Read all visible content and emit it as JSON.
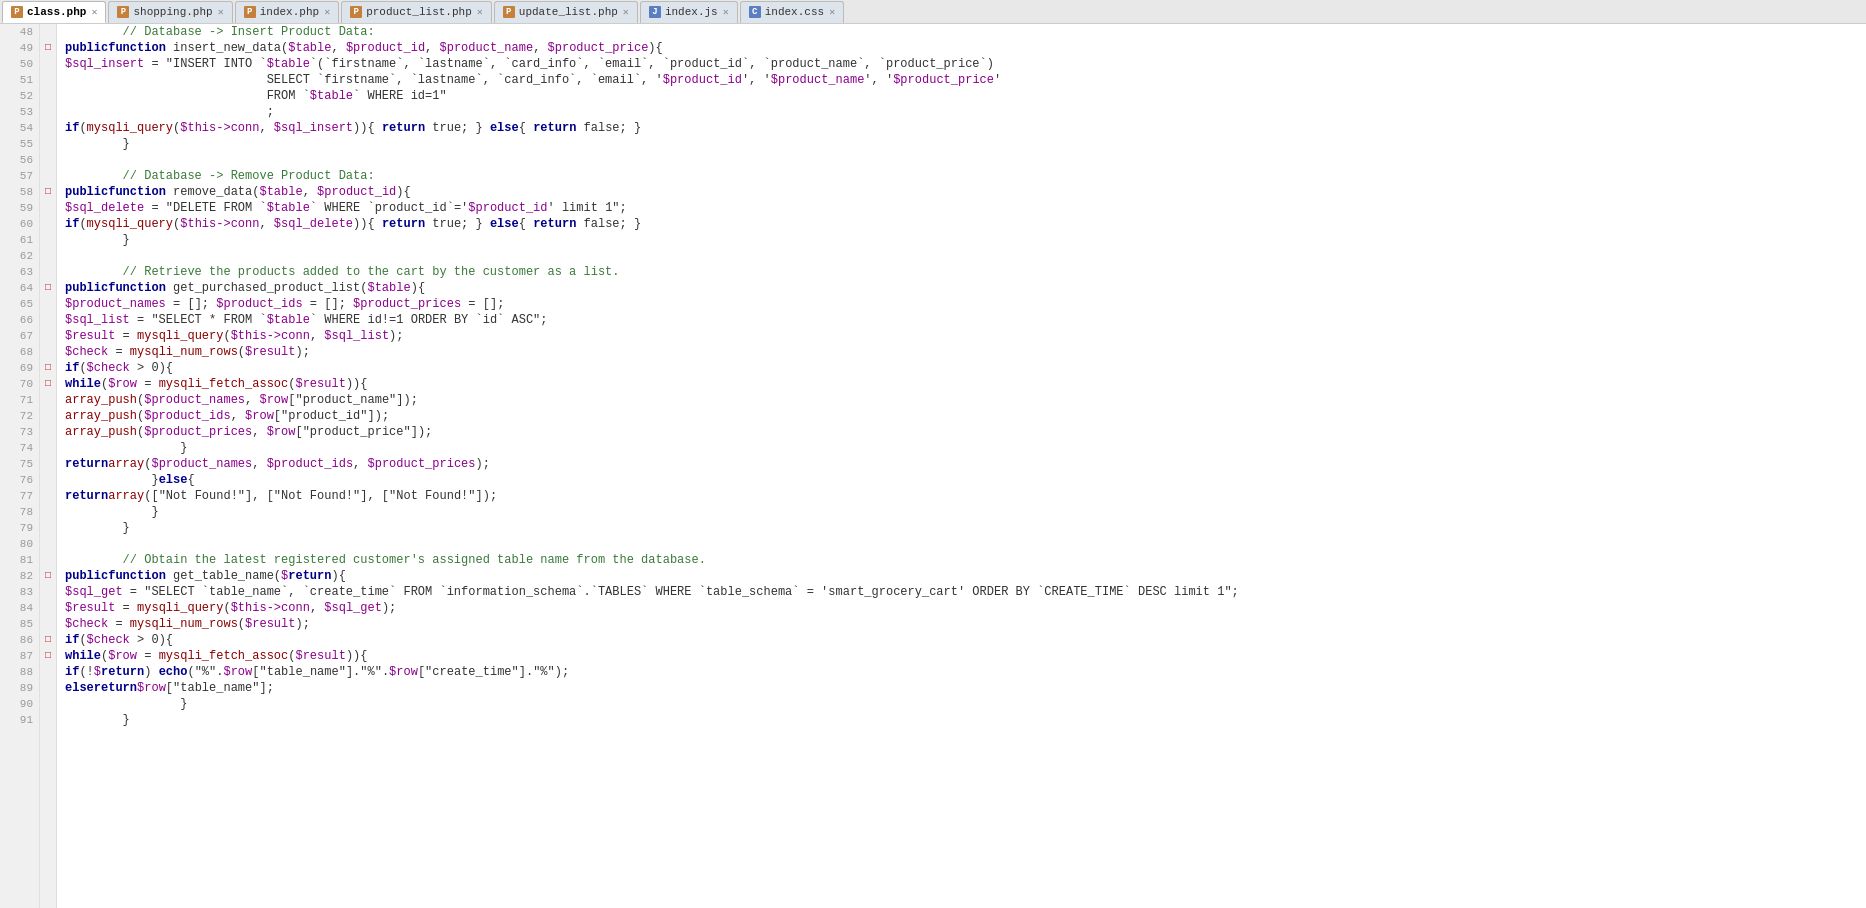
{
  "tabs": [
    {
      "id": "class-php",
      "label": "class.php",
      "icon": "php",
      "iconColor": "orange",
      "active": true
    },
    {
      "id": "shopping-php",
      "label": "shopping.php",
      "icon": "php",
      "iconColor": "orange",
      "active": false
    },
    {
      "id": "index-php",
      "label": "index.php",
      "icon": "php",
      "iconColor": "orange",
      "active": false
    },
    {
      "id": "product-list-php",
      "label": "product_list.php",
      "icon": "php",
      "iconColor": "orange",
      "active": false
    },
    {
      "id": "update-list-php",
      "label": "update_list.php",
      "icon": "php",
      "iconColor": "orange",
      "active": false
    },
    {
      "id": "index-js",
      "label": "index.js",
      "icon": "js",
      "iconColor": "blue",
      "active": false
    },
    {
      "id": "index-css",
      "label": "index.css",
      "icon": "css",
      "iconColor": "blue",
      "active": false
    }
  ],
  "lines": [
    {
      "num": 48,
      "fold": "",
      "code": "        // Database -> Insert Product Data:"
    },
    {
      "num": 49,
      "fold": "-",
      "code": "        public function insert_new_data($table, $product_id, $product_name, $product_price){"
    },
    {
      "num": 50,
      "fold": "",
      "code": "            $sql_insert = \"INSERT INTO `$table`(`firstname`, `lastname`, `card_info`, `email`, `product_id`, `product_name`, `product_price`)"
    },
    {
      "num": 51,
      "fold": "",
      "code": "                            SELECT `firstname`, `lastname`, `card_info`, `email`, '$product_id', '$product_name', '$product_price'"
    },
    {
      "num": 52,
      "fold": "",
      "code": "                            FROM `$table` WHERE id=1\""
    },
    {
      "num": 53,
      "fold": "",
      "code": "                            ;"
    },
    {
      "num": 54,
      "fold": "",
      "code": "            if(mysqli_query($this->conn, $sql_insert)){ return true; } else{ return false; }"
    },
    {
      "num": 55,
      "fold": "",
      "code": "        }"
    },
    {
      "num": 56,
      "fold": "",
      "code": ""
    },
    {
      "num": 57,
      "fold": "",
      "code": "        // Database -> Remove Product Data:"
    },
    {
      "num": 58,
      "fold": "-",
      "code": "        public function remove_data($table, $product_id){"
    },
    {
      "num": 59,
      "fold": "",
      "code": "            $sql_delete = \"DELETE FROM `$table` WHERE `product_id`='$product_id' limit 1\";"
    },
    {
      "num": 60,
      "fold": "",
      "code": "            if(mysqli_query($this->conn, $sql_delete)){ return true; } else{ return false; }"
    },
    {
      "num": 61,
      "fold": "",
      "code": "        }"
    },
    {
      "num": 62,
      "fold": "",
      "code": ""
    },
    {
      "num": 63,
      "fold": "",
      "code": "        // Retrieve the products added to the cart by the customer as a list."
    },
    {
      "num": 64,
      "fold": "-",
      "code": "        public function get_purchased_product_list($table){"
    },
    {
      "num": 65,
      "fold": "",
      "code": "            $product_names = []; $product_ids = []; $product_prices = [];"
    },
    {
      "num": 66,
      "fold": "",
      "code": "            $sql_list = \"SELECT * FROM `$table` WHERE id!=1 ORDER BY `id` ASC\";"
    },
    {
      "num": 67,
      "fold": "",
      "code": "            $result = mysqli_query($this->conn, $sql_list);"
    },
    {
      "num": 68,
      "fold": "",
      "code": "            $check = mysqli_num_rows($result);"
    },
    {
      "num": 69,
      "fold": "-",
      "code": "            if($check > 0){"
    },
    {
      "num": 70,
      "fold": "-",
      "code": "                while($row = mysqli_fetch_assoc($result)){"
    },
    {
      "num": 71,
      "fold": "",
      "code": "                    array_push($product_names, $row[\"product_name\"]);"
    },
    {
      "num": 72,
      "fold": "",
      "code": "                    array_push($product_ids, $row[\"product_id\"]);"
    },
    {
      "num": 73,
      "fold": "",
      "code": "                    array_push($product_prices, $row[\"product_price\"]);"
    },
    {
      "num": 74,
      "fold": "",
      "code": "                }"
    },
    {
      "num": 75,
      "fold": "",
      "code": "                return array($product_names, $product_ids, $product_prices);"
    },
    {
      "num": 76,
      "fold": "",
      "code": "            }else{"
    },
    {
      "num": 77,
      "fold": "",
      "code": "                return array([\"Not Found!\"], [\"Not Found!\"], [\"Not Found!\"]);"
    },
    {
      "num": 78,
      "fold": "",
      "code": "            }"
    },
    {
      "num": 79,
      "fold": "",
      "code": "        }"
    },
    {
      "num": 80,
      "fold": "",
      "code": ""
    },
    {
      "num": 81,
      "fold": "",
      "code": "        // Obtain the latest registered customer's assigned table name from the database."
    },
    {
      "num": 82,
      "fold": "-",
      "code": "        public function get_table_name($return){"
    },
    {
      "num": 83,
      "fold": "",
      "code": "            $sql_get = \"SELECT `table_name`, `create_time` FROM `information_schema`.`TABLES` WHERE `table_schema` = 'smart_grocery_cart' ORDER BY `CREATE_TIME` DESC limit 1\";"
    },
    {
      "num": 84,
      "fold": "",
      "code": "            $result = mysqli_query($this->conn, $sql_get);"
    },
    {
      "num": 85,
      "fold": "",
      "code": "            $check = mysqli_num_rows($result);"
    },
    {
      "num": 86,
      "fold": "-",
      "code": "            if($check > 0){"
    },
    {
      "num": 87,
      "fold": "-",
      "code": "                while($row = mysqli_fetch_assoc($result)){"
    },
    {
      "num": 88,
      "fold": "",
      "code": "                    if(!$return) echo(\"%\".$row[\"table_name\"].\"%\".$row[\"create_time\"].\"%\");"
    },
    {
      "num": 89,
      "fold": "",
      "code": "                    else return $row[\"table_name\"];"
    },
    {
      "num": 90,
      "fold": "",
      "code": "                }"
    },
    {
      "num": 91,
      "fold": "",
      "code": "        }"
    }
  ]
}
